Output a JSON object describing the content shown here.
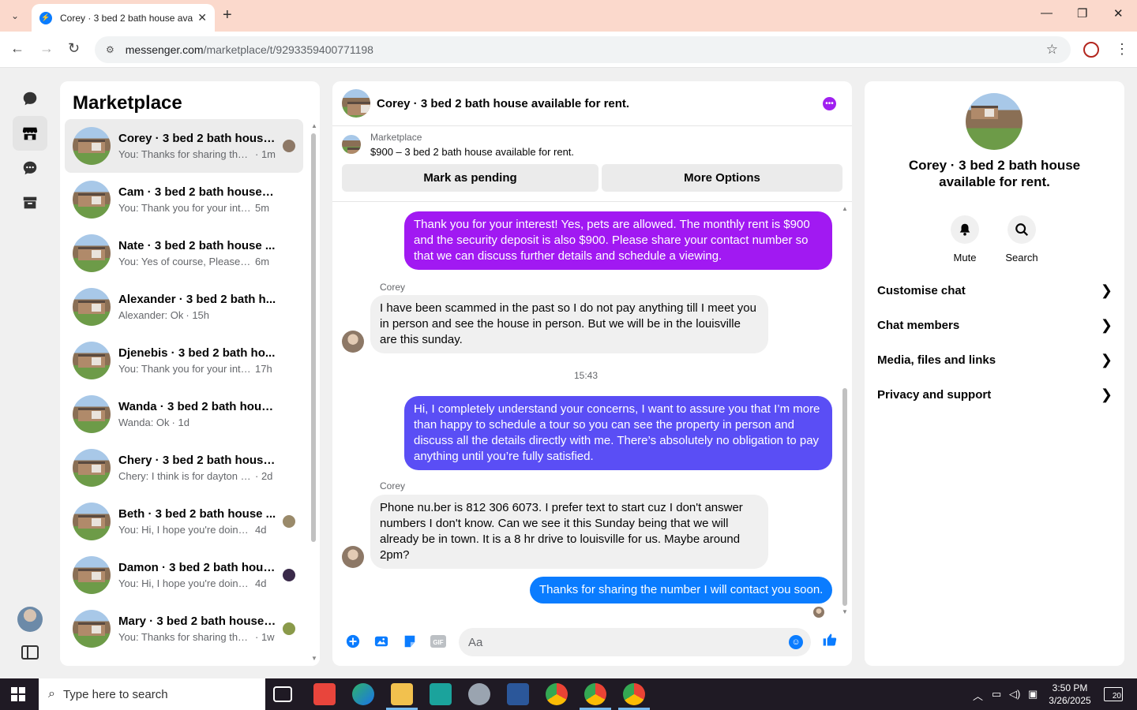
{
  "browser": {
    "tab_title": "Corey · 3 bed 2 bath house ava",
    "url_host": "messenger.com",
    "url_path": "/marketplace/t/9293359400771198"
  },
  "sidebar": {
    "title": "Marketplace",
    "conversations": [
      {
        "name": "Corey · 3 bed 2 bath house...",
        "snippet": "You: Thanks for sharing the ...",
        "time": "· 1m",
        "seen": "#8d7866",
        "active": true
      },
      {
        "name": "Cam · 3 bed 2 bath house a...",
        "snippet": "You: Thank you for your inte...",
        "time": "5m",
        "seen": ""
      },
      {
        "name": "Nate · 3 bed 2 bath house ...",
        "snippet": "You: Yes of course, Please sh...",
        "time": "6m",
        "seen": ""
      },
      {
        "name": "Alexander · 3 bed 2 bath h...",
        "snippet": "Alexander: Ok",
        "time": "· 15h",
        "seen": ""
      },
      {
        "name": "Djenebis · 3 bed 2 bath ho...",
        "snippet": "You: Thank you for your inte...",
        "time": "17h",
        "seen": ""
      },
      {
        "name": "Wanda · 3 bed 2 bath hous...",
        "snippet": "Wanda: Ok",
        "time": "· 1d",
        "seen": ""
      },
      {
        "name": "Chery · 3 bed 2 bath house...",
        "snippet": "Chery: I think is for dayton ex...",
        "time": "· 2d",
        "seen": ""
      },
      {
        "name": "Beth · 3 bed 2 bath house ...",
        "snippet": "You: Hi, I hope you're doing ...",
        "time": "4d",
        "seen": "#9a8a6a"
      },
      {
        "name": "Damon · 3 bed 2 bath hous...",
        "snippet": "You: Hi, I hope you're doing ...",
        "time": "4d",
        "seen": "#3a2a4a"
      },
      {
        "name": "Mary · 3 bed 2 bath house ...",
        "snippet": "You: Thanks for sharing the n...",
        "time": "· 1w",
        "seen": "#8a9a4a"
      }
    ]
  },
  "chat": {
    "title": "Corey · 3 bed 2 bath house available for rent.",
    "marketplace_label": "Marketplace",
    "listing": "$900 – 3 bed 2 bath house available for rent.",
    "mark_pending": "Mark as pending",
    "more_options": "More Options",
    "messages": {
      "m1": "Thank you for your interest! Yes, pets are allowed. The monthly rent is $900 and the security deposit is also $900. Please share your contact number so that we can discuss further details and schedule a viewing.",
      "sender1": "Corey",
      "m2": "I have been scammed in the past so I do not pay anything till I meet you in person and see the house in person. But we will be in the louisville are this sunday.",
      "time": "15:43",
      "m3": "Hi, I completely understand your concerns, I want to assure you that I’m more than happy to schedule a tour so you can see the property in person and discuss all the details directly with me. There’s absolutely no obligation to pay anything until you’re fully satisfied.",
      "sender2": "Corey",
      "m4": "Phone nu.ber is 812 306 6073. I prefer text to start cuz I don't answer numbers I don't know. Can we see it this Sunday being that we will already be in town. It is a 8 hr drive to louisville for us. Maybe around 2pm?",
      "m5": "Thanks for sharing the number I will contact you soon."
    },
    "colors": {
      "m1": "#a119f2",
      "m3": "#5a4ef5",
      "m5": "#0a7cff"
    },
    "composer_placeholder": "Aa"
  },
  "info": {
    "name": "Corey · 3 bed 2 bath house available for rent.",
    "mute": "Mute",
    "search": "Search",
    "rows": [
      "Customise chat",
      "Chat members",
      "Media, files and links",
      "Privacy and support"
    ]
  },
  "taskbar": {
    "search_placeholder": "Type here to search",
    "time": "3:50 PM",
    "date": "3/26/2025",
    "notifications": "20"
  }
}
